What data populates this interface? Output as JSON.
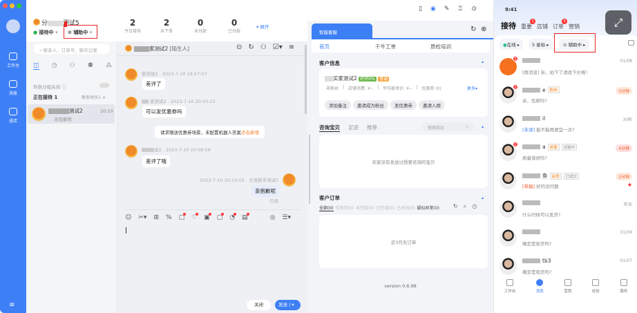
{
  "sidebar": {
    "items": [
      {
        "label": "工作台"
      },
      {
        "label": "消息"
      },
      {
        "label": "进店"
      }
    ]
  },
  "header": {
    "name_prefix": "分",
    "name_suffix": "测试5",
    "status": "接待中",
    "assist": "辅助中",
    "stats": [
      {
        "value": "2",
        "label": "今日接待"
      },
      {
        "value": "2",
        "label": "未下单"
      },
      {
        "value": "0",
        "label": "未付款"
      },
      {
        "value": "0",
        "label": "已付款"
      }
    ],
    "expand": "展开"
  },
  "contacts": {
    "search_placeholder": "联系人、订单号、聊天记录",
    "group_toggle": "列表分组关闭",
    "section": "正在接待",
    "section_count": "1",
    "sort": "联系时间↓",
    "items": [
      {
        "name": "测试2",
        "time": "20:10",
        "preview": "亲抱歉呢"
      }
    ]
  },
  "chat": {
    "title": "家测试2",
    "title_tag": "[陌生人]",
    "messages": [
      {
        "name": "家测试2",
        "time": "2023-7-10 19:57:57",
        "text": "差评了"
      },
      {
        "name": "家测试2",
        "time": "2023-7-10 20:03:15",
        "text": "可以发优惠券吗"
      },
      {
        "name": "试2",
        "time": "2023-7-10 20:09:59",
        "text": "差评了哦"
      }
    ],
    "system_notice": "请求赠送优惠券场景，未配置机器人答案",
    "system_link": "点击新增",
    "outgoing": {
      "name": "分流新手测试5",
      "time": "2023-7-10 20:10:02",
      "text": "亲抱歉呢",
      "status": "已读"
    },
    "close_label": "关闭",
    "send_label": "发送"
  },
  "rpanel": {
    "tab": "智能客服",
    "subtabs": [
      "首页",
      "千牛工单",
      "质检培训"
    ],
    "customer_title": "客户信息",
    "customer_name": "买家测试2",
    "rating": "好评0%",
    "level": "普通",
    "customer_stats": [
      "非粉丝",
      "店铺消费: ¥--",
      "平均客单价: ¥--",
      "优惠券 (0)"
    ],
    "more": "更多",
    "actions": [
      "添加备注",
      "邀请成为粉丝",
      "发优惠券",
      "邀请入群"
    ],
    "goods_tabs": [
      "咨询宝贝",
      "足迹",
      "推荐"
    ],
    "goods_search_placeholder": "搜索商品",
    "goods_empty": "买家没有发送过想要咨询的宝贝",
    "orders_title": "客户订单",
    "order_tabs": [
      "全部(0)",
      "待发货(0)",
      "未完成(0)",
      "已完成(0)",
      "已关闭(0)",
      "疑似异常(0)"
    ],
    "orders_empty": "近3月无订单",
    "version": "version 0.6.98"
  },
  "phone": {
    "time": "9:41",
    "tabs": [
      {
        "label": "接待",
        "badge": ""
      },
      {
        "label": "重要",
        "badge": "1"
      },
      {
        "label": "店铺",
        "badge": ""
      },
      {
        "label": "订单",
        "badge": "3"
      },
      {
        "label": "营销",
        "badge": ""
      }
    ],
    "filters": [
      "在线",
      "5 星标",
      "辅助中"
    ],
    "list": [
      {
        "name": "",
        "badge": "3",
        "time": "01/08",
        "prefix": "[群消息]",
        "msg": " 亲，拍下了请改下价格！",
        "tags": [],
        "mi": true
      },
      {
        "name": "e",
        "badge": "2",
        "time": "3分钟",
        "prefix": "",
        "msg": "亲，包邮吗?",
        "tags": [
          "粉丝"
        ]
      },
      {
        "name": "il",
        "badge": "",
        "time": "30秒",
        "prefix": "[未读]",
        "msg": " 能不能再便宜一点?",
        "tags": []
      },
      {
        "name": "a",
        "badge": "2",
        "time": "4分钟",
        "prefix": "",
        "msg": "质量保修吗?",
        "tags": [
          "老客",
          "运输中"
        ]
      },
      {
        "name": "鱼",
        "badge": "",
        "time": "2分钟",
        "prefix": "[草稿]",
        "msg": " 好的没问题",
        "tags": [
          "会员",
          "已成交"
        ],
        "star": true
      },
      {
        "name": "",
        "badge": "",
        "time": "昨天",
        "prefix": "",
        "msg": "什么时候可以发货?",
        "tags": []
      },
      {
        "name": "",
        "badge": "",
        "time": "01/09",
        "prefix": "",
        "msg": "确定是现货吗?",
        "tags": []
      },
      {
        "name": "tb3",
        "badge": "",
        "time": "01/07",
        "prefix": "",
        "msg": "确定是现货吗?",
        "tags": []
      }
    ],
    "nav": [
      "工作台",
      "消息",
      "营销",
      "经验",
      "服务"
    ]
  }
}
